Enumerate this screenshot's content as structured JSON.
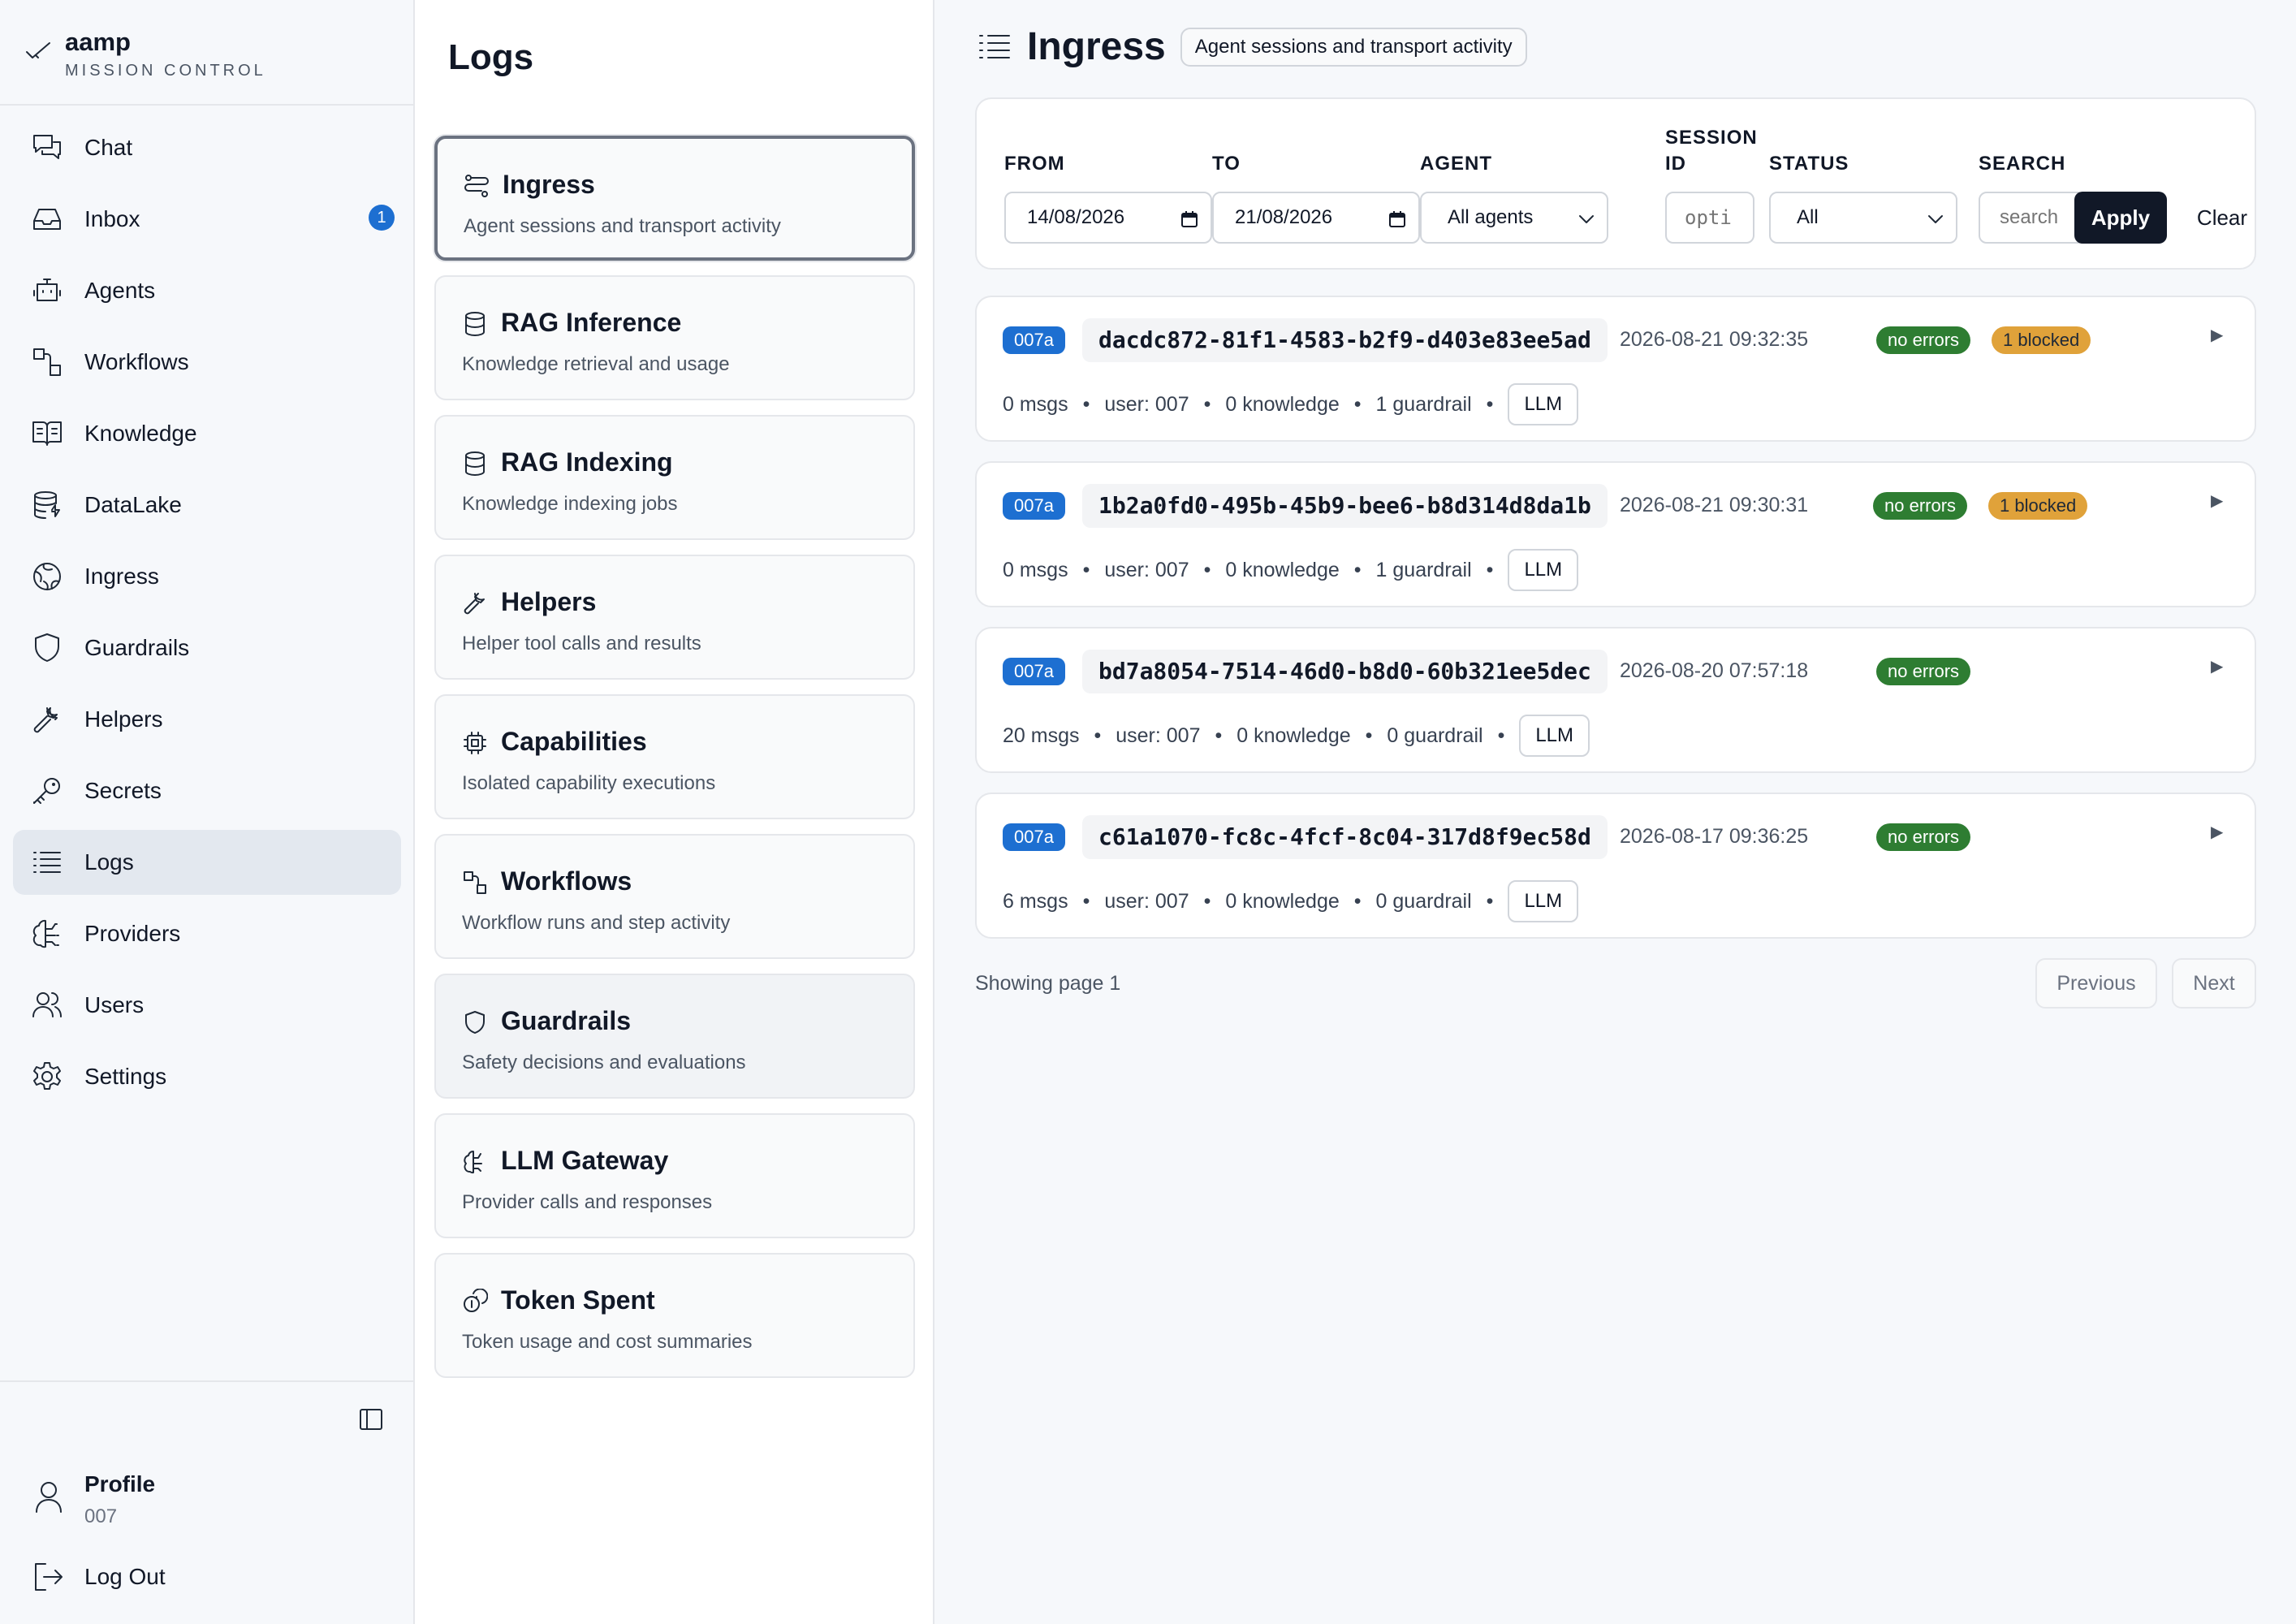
{
  "brand": {
    "name": "aamp",
    "subtitle": "MISSION CONTROL"
  },
  "sidebar": {
    "items": [
      {
        "label": "Chat",
        "icon": "chat-icon"
      },
      {
        "label": "Inbox",
        "icon": "inbox-icon",
        "badge": "1"
      },
      {
        "label": "Agents",
        "icon": "robot-icon"
      },
      {
        "label": "Workflows",
        "icon": "workflow-icon"
      },
      {
        "label": "Knowledge",
        "icon": "book-icon"
      },
      {
        "label": "DataLake",
        "icon": "database-icon"
      },
      {
        "label": "Ingress",
        "icon": "globe-icon"
      },
      {
        "label": "Guardrails",
        "icon": "shield-icon"
      },
      {
        "label": "Helpers",
        "icon": "wrench-icon"
      },
      {
        "label": "Secrets",
        "icon": "key-icon"
      },
      {
        "label": "Logs",
        "icon": "list-icon",
        "active": true
      },
      {
        "label": "Providers",
        "icon": "brain-icon"
      },
      {
        "label": "Users",
        "icon": "users-icon"
      },
      {
        "label": "Settings",
        "icon": "gear-icon"
      }
    ],
    "profile": {
      "label": "Profile",
      "user": "007"
    },
    "logout": "Log Out"
  },
  "logs": {
    "title": "Logs",
    "cards": [
      {
        "title": "Ingress",
        "desc": "Agent sessions and transport activity",
        "icon": "route-icon"
      },
      {
        "title": "RAG Inference",
        "desc": "Knowledge retrieval and usage",
        "icon": "database-icon"
      },
      {
        "title": "RAG Indexing",
        "desc": "Knowledge indexing jobs",
        "icon": "database-icon"
      },
      {
        "title": "Helpers",
        "desc": "Helper tool calls and results",
        "icon": "wrench-icon"
      },
      {
        "title": "Capabilities",
        "desc": "Isolated capability executions",
        "icon": "chip-icon"
      },
      {
        "title": "Workflows",
        "desc": "Workflow runs and step activity",
        "icon": "workflow-icon"
      },
      {
        "title": "Guardrails",
        "desc": "Safety decisions and evaluations",
        "icon": "shield-icon"
      },
      {
        "title": "LLM Gateway",
        "desc": "Provider calls and responses",
        "icon": "brain-icon"
      },
      {
        "title": "Token Spent",
        "desc": "Token usage and cost summaries",
        "icon": "coins-icon"
      }
    ]
  },
  "main": {
    "title": "Ingress",
    "subtitle": "Agent sessions and transport activity",
    "filters": {
      "from_label": "FROM",
      "from_value": "14/08/2026",
      "to_label": "TO",
      "to_value": "21/08/2026",
      "agent_label": "AGENT",
      "agent_value": "All agents",
      "session_label_1": "SESSION",
      "session_label_2": "ID",
      "session_placeholder": "opti",
      "status_label": "STATUS",
      "status_value": "All",
      "search_label": "SEARCH",
      "search_placeholder": "search",
      "apply": "Apply",
      "clear": "Clear"
    },
    "sessions": [
      {
        "agent": "007a",
        "id": "dacdc872-81f1-4583-b2f9-d403e83ee5ad",
        "time": "2026-08-21 09:32:35",
        "errors": "no errors",
        "blocked": "1 blocked",
        "msgs": "0 msgs",
        "user": "user: 007",
        "knowledge": "0 knowledge",
        "guardrail": "1 guardrail",
        "llm": "LLM"
      },
      {
        "agent": "007a",
        "id": "1b2a0fd0-495b-45b9-bee6-b8d314d8da1b",
        "time": "2026-08-21 09:30:31",
        "errors": "no errors",
        "blocked": "1 blocked",
        "msgs": "0 msgs",
        "user": "user: 007",
        "knowledge": "0 knowledge",
        "guardrail": "1 guardrail",
        "llm": "LLM"
      },
      {
        "agent": "007a",
        "id": "bd7a8054-7514-46d0-b8d0-60b321ee5dec",
        "time": "2026-08-20 07:57:18",
        "errors": "no errors",
        "blocked": "",
        "msgs": "20 msgs",
        "user": "user: 007",
        "knowledge": "0 knowledge",
        "guardrail": "0 guardrail",
        "llm": "LLM"
      },
      {
        "agent": "007a",
        "id": "c61a1070-fc8c-4fcf-8c04-317d8f9ec58d",
        "time": "2026-08-17 09:36:25",
        "errors": "no errors",
        "blocked": "",
        "msgs": "6 msgs",
        "user": "user: 007",
        "knowledge": "0 knowledge",
        "guardrail": "0 guardrail",
        "llm": "LLM"
      }
    ],
    "pager": {
      "text": "Showing page 1",
      "previous": "Previous",
      "next": "Next"
    }
  },
  "colors": {
    "accent": "#1d6fd1",
    "ok": "#2e7d32",
    "warn": "#e0a23a",
    "dark": "#111827"
  }
}
